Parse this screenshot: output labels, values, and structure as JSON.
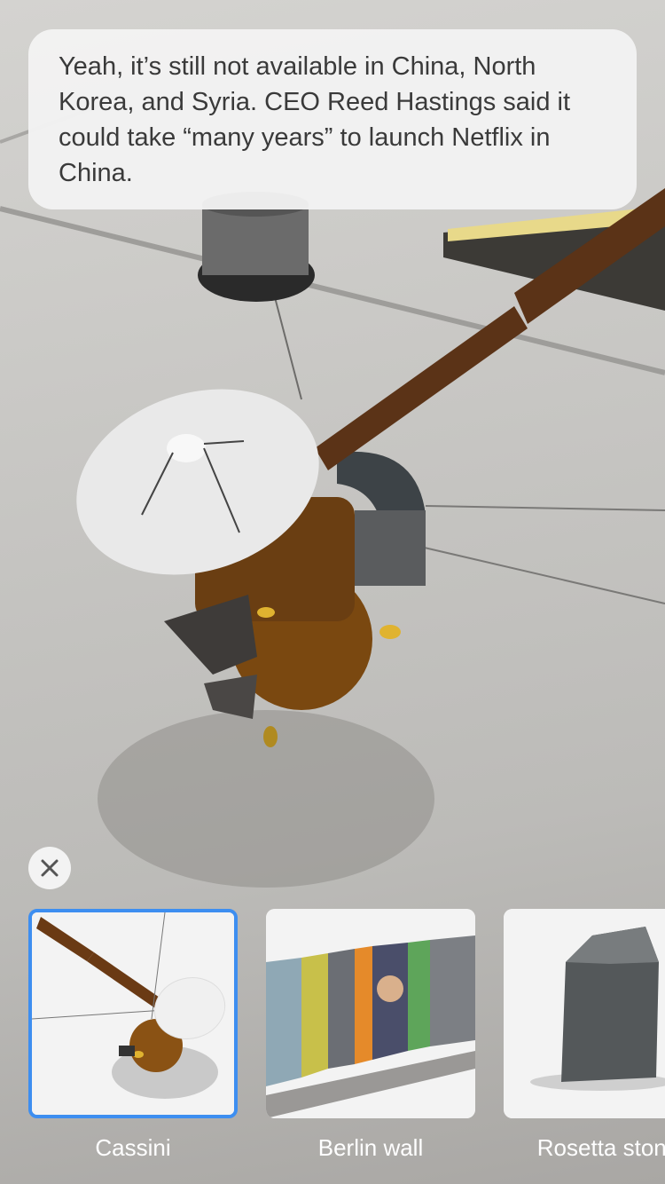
{
  "speech_bubble": {
    "text": "Yeah, it’s still not available in China, North Korea, and Syria. CEO Reed Hastings said it could take “many years” to launch Netflix in China."
  },
  "close_icon": "close-icon",
  "models": [
    {
      "label": "Cassini",
      "selected": true,
      "icon": "cassini-thumbnail"
    },
    {
      "label": "Berlin wall",
      "selected": false,
      "icon": "berlin-wall-thumbnail"
    },
    {
      "label": "Rosetta stone",
      "selected": false,
      "icon": "rosetta-stone-thumbnail"
    }
  ],
  "colors": {
    "selection_border": "#3d8ef0",
    "bubble_background": "#f2f2f2",
    "label_text": "#ffffff"
  }
}
